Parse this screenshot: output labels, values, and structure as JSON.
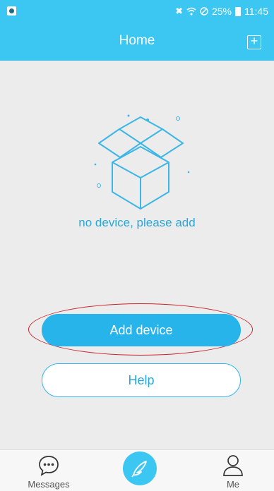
{
  "status_bar": {
    "battery": "25%",
    "time": "11:45",
    "icons": [
      "app-notification-icon",
      "mute-icon",
      "wifi-icon",
      "no-sim-icon",
      "battery-icon"
    ]
  },
  "header": {
    "title": "Home",
    "add_icon": "plus-square-icon"
  },
  "empty_state": {
    "illustration": "empty-box-icon",
    "text": "no device, please add"
  },
  "actions": {
    "add_device": "Add device",
    "help": "Help"
  },
  "tab_bar": {
    "messages": {
      "label": "Messages",
      "icon": "chat-bubble-icon"
    },
    "center": {
      "icon": "feather-icon"
    },
    "me": {
      "label": "Me",
      "icon": "person-icon"
    }
  },
  "colors": {
    "brand": "#3cc7f2",
    "button": "#27b4ea",
    "text_accent": "#2aa7d9",
    "annotation": "#c9242c"
  }
}
